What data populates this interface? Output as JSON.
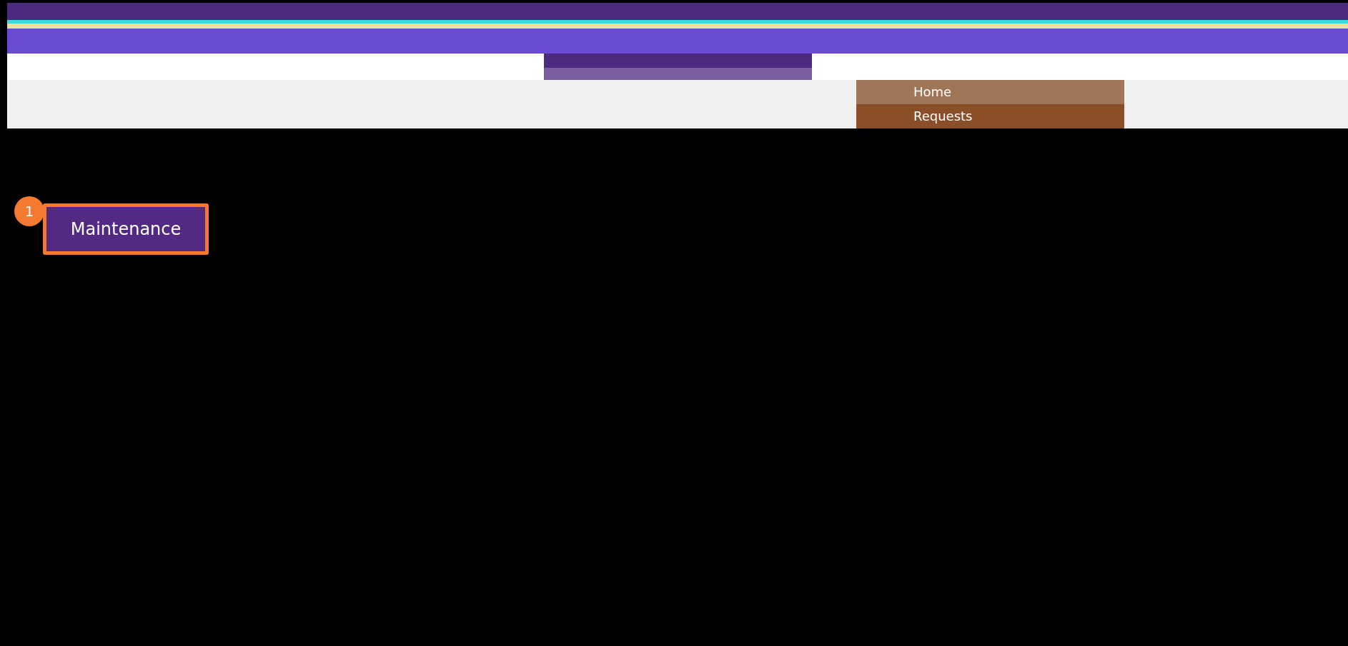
{
  "menu": {
    "items": [
      {
        "label": "Home",
        "selected": true
      },
      {
        "label": "Requests",
        "selected": false
      }
    ]
  },
  "step": {
    "number": "1",
    "button": "Maintenance"
  }
}
